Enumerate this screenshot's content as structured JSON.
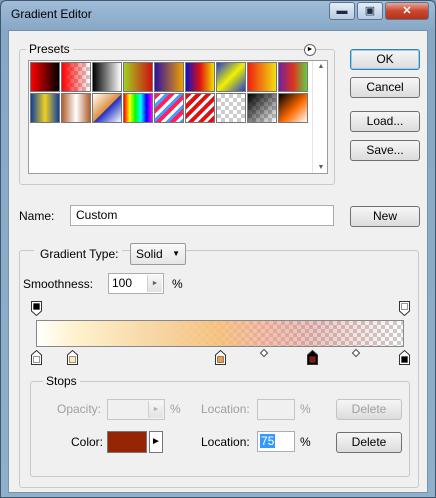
{
  "window": {
    "title": "Gradient Editor",
    "min_glyph": "▬",
    "max_glyph": "▣",
    "close_glyph": "✕"
  },
  "presets": {
    "title": "Presets",
    "menu_glyph": "►",
    "scroll_up": "▲",
    "scroll_down": "▼",
    "swatches": [
      {
        "css": "linear-gradient(90deg,#ff0000,#000000)"
      },
      {
        "css": "linear-gradient(90deg,#ff0000,rgba(255,0,0,0))",
        "alpha": true
      },
      {
        "css": "linear-gradient(90deg,#000000,#ffffff)"
      },
      {
        "css": "linear-gradient(90deg,#a0d020,#d01010)"
      },
      {
        "css": "linear-gradient(90deg,#3010a0,#f0a000)"
      },
      {
        "css": "linear-gradient(90deg,#1010c0,#e01010,#f0e000)"
      },
      {
        "css": "linear-gradient(135deg,#2040d0,#f0f000,#2040d0)"
      },
      {
        "css": "linear-gradient(90deg,#f02010,#f0e010)"
      },
      {
        "css": "linear-gradient(90deg,#7020a0,#e03020,#60d040)"
      },
      {
        "css": "linear-gradient(90deg,#1040a0,#f0d020,#1040a0)"
      },
      {
        "css": "linear-gradient(90deg,#b06030,#ffffff,#b06030)"
      },
      {
        "css": "linear-gradient(135deg,#ffffff,#e09040 50%,#2030c0 52%,#ffffff)"
      },
      {
        "css": "linear-gradient(90deg,#ff0000,#ffff00,#00ff00,#00ffff,#0000ff,#ff00ff)"
      },
      {
        "css": "repeating-linear-gradient(135deg,#ff2060 0 4px,#ffffff 4px 7px,#40a0ff 7px 10px)",
        "alpha": true
      },
      {
        "css": "repeating-linear-gradient(135deg,#e01010 0 4px,#ffffff 4px 7px)"
      },
      {
        "css": "linear-gradient(90deg,rgba(200,200,200,0),rgba(200,200,200,0))",
        "alpha": true
      },
      {
        "css": "linear-gradient(135deg,#000000,rgba(0,0,0,0))",
        "alpha": true
      },
      {
        "css": "linear-gradient(135deg,#000000,#ff6a00 55%,#ffffff)"
      }
    ]
  },
  "buttons": {
    "ok": "OK",
    "cancel": "Cancel",
    "load": "Load...",
    "save": "Save...",
    "new": "New"
  },
  "name": {
    "label": "Name:",
    "value": "Custom"
  },
  "gradient_type": {
    "label": "Gradient Type:",
    "value": "Solid",
    "arrow": "▼"
  },
  "smoothness": {
    "label": "Smoothness:",
    "value": "100",
    "unit": "%",
    "arrow": "►"
  },
  "gradient_bar": {
    "css": "linear-gradient(90deg,#ffffff 0%,#fff2cf 10%,#f7d9a8 30%,rgba(246,190,120,0.9) 50%,rgba(240,150,120,0.6) 62%,rgba(210,110,100,0.4) 75%,rgba(200,200,200,0) 100%)"
  },
  "opacity_stops": [
    {
      "location": 0,
      "color": "#000000"
    },
    {
      "location": 100,
      "color": "#ffffff"
    }
  ],
  "color_stops": [
    {
      "location": 0,
      "color": "#ffffff"
    },
    {
      "location": 10,
      "color": "#ffe9b6"
    },
    {
      "location": 50,
      "color": "#f29a4a"
    },
    {
      "location": 75,
      "color": "#8b1a0c",
      "selected": true
    },
    {
      "location": 100,
      "color": "#000000"
    }
  ],
  "midpoints": [
    62,
    87
  ],
  "stops": {
    "title": "Stops",
    "opacity_label": "Opacity:",
    "opacity_unit": "%",
    "opacity_location_label": "Location:",
    "opacity_location_unit": "%",
    "delete_top": "Delete",
    "color_label": "Color:",
    "color_value": "#962506",
    "color_arrow": "►",
    "color_location_label": "Location:",
    "color_location_value": "75",
    "color_location_unit": "%",
    "delete_bottom": "Delete"
  }
}
